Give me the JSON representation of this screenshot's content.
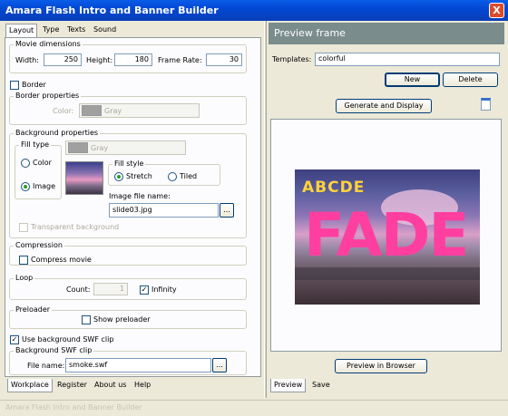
{
  "window": {
    "title": "Amara Flash Intro and Banner Builder",
    "close_glyph": "X"
  },
  "tabs": [
    "Layout",
    "Type",
    "Texts",
    "Sound"
  ],
  "movie_dimensions": {
    "label": "Movie dimensions",
    "width_label": "Width:",
    "width_value": "250",
    "height_label": "Height:",
    "height_value": "180",
    "framerate_label": "Frame Rate:",
    "framerate_value": "30"
  },
  "border": {
    "checkbox_label": "Border",
    "properties_label": "Border properties",
    "color_label": "Color:",
    "color_value": "Gray"
  },
  "background": {
    "label": "Background properties",
    "fill_type_label": "Fill type",
    "color_option": "Color",
    "image_option": "Image",
    "color_value": "Gray",
    "fill_style_label": "Fill style",
    "stretch_option": "Stretch",
    "tiled_option": "Tiled",
    "image_file_label": "Image file name:",
    "image_file_value": "slide03.jpg",
    "browse_label": "...",
    "transparent_label": "Transparent background"
  },
  "compression": {
    "label": "Compression",
    "compress_label": "Compress movie"
  },
  "loop": {
    "label": "Loop",
    "count_label": "Count:",
    "count_value": "1",
    "infinity_label": "Infinity"
  },
  "preloader": {
    "label": "Preloader",
    "show_label": "Show preloader"
  },
  "swf": {
    "use_label": "Use background SWF clip",
    "clip_label": "Background SWF clip",
    "file_label": "File name:",
    "file_value": "smoke.swf",
    "browse_label": "..."
  },
  "left_bottom_tabs": [
    "Workplace",
    "Register",
    "About us",
    "Help"
  ],
  "preview": {
    "header": "Preview frame",
    "templates_label": "Templates:",
    "templates_value": "colorful",
    "new_label": "New",
    "delete_label": "Delete",
    "generate_label": "Generate and Display",
    "browser_label": "Preview in Browser",
    "banner_letters_top": "ABCDE",
    "banner_letters_big": "FADE",
    "colors": {
      "accent_pink": "#ff3fa0",
      "accent_yellow": "#ffd23c"
    }
  },
  "right_bottom_tabs": [
    "Preview",
    "Save"
  ],
  "status": "Amara Flash Intro and Banner Builder",
  "colors": {
    "titlebar": "#0148d4",
    "panel": "#ece9d8",
    "preview_header": "#7b8c8d"
  }
}
